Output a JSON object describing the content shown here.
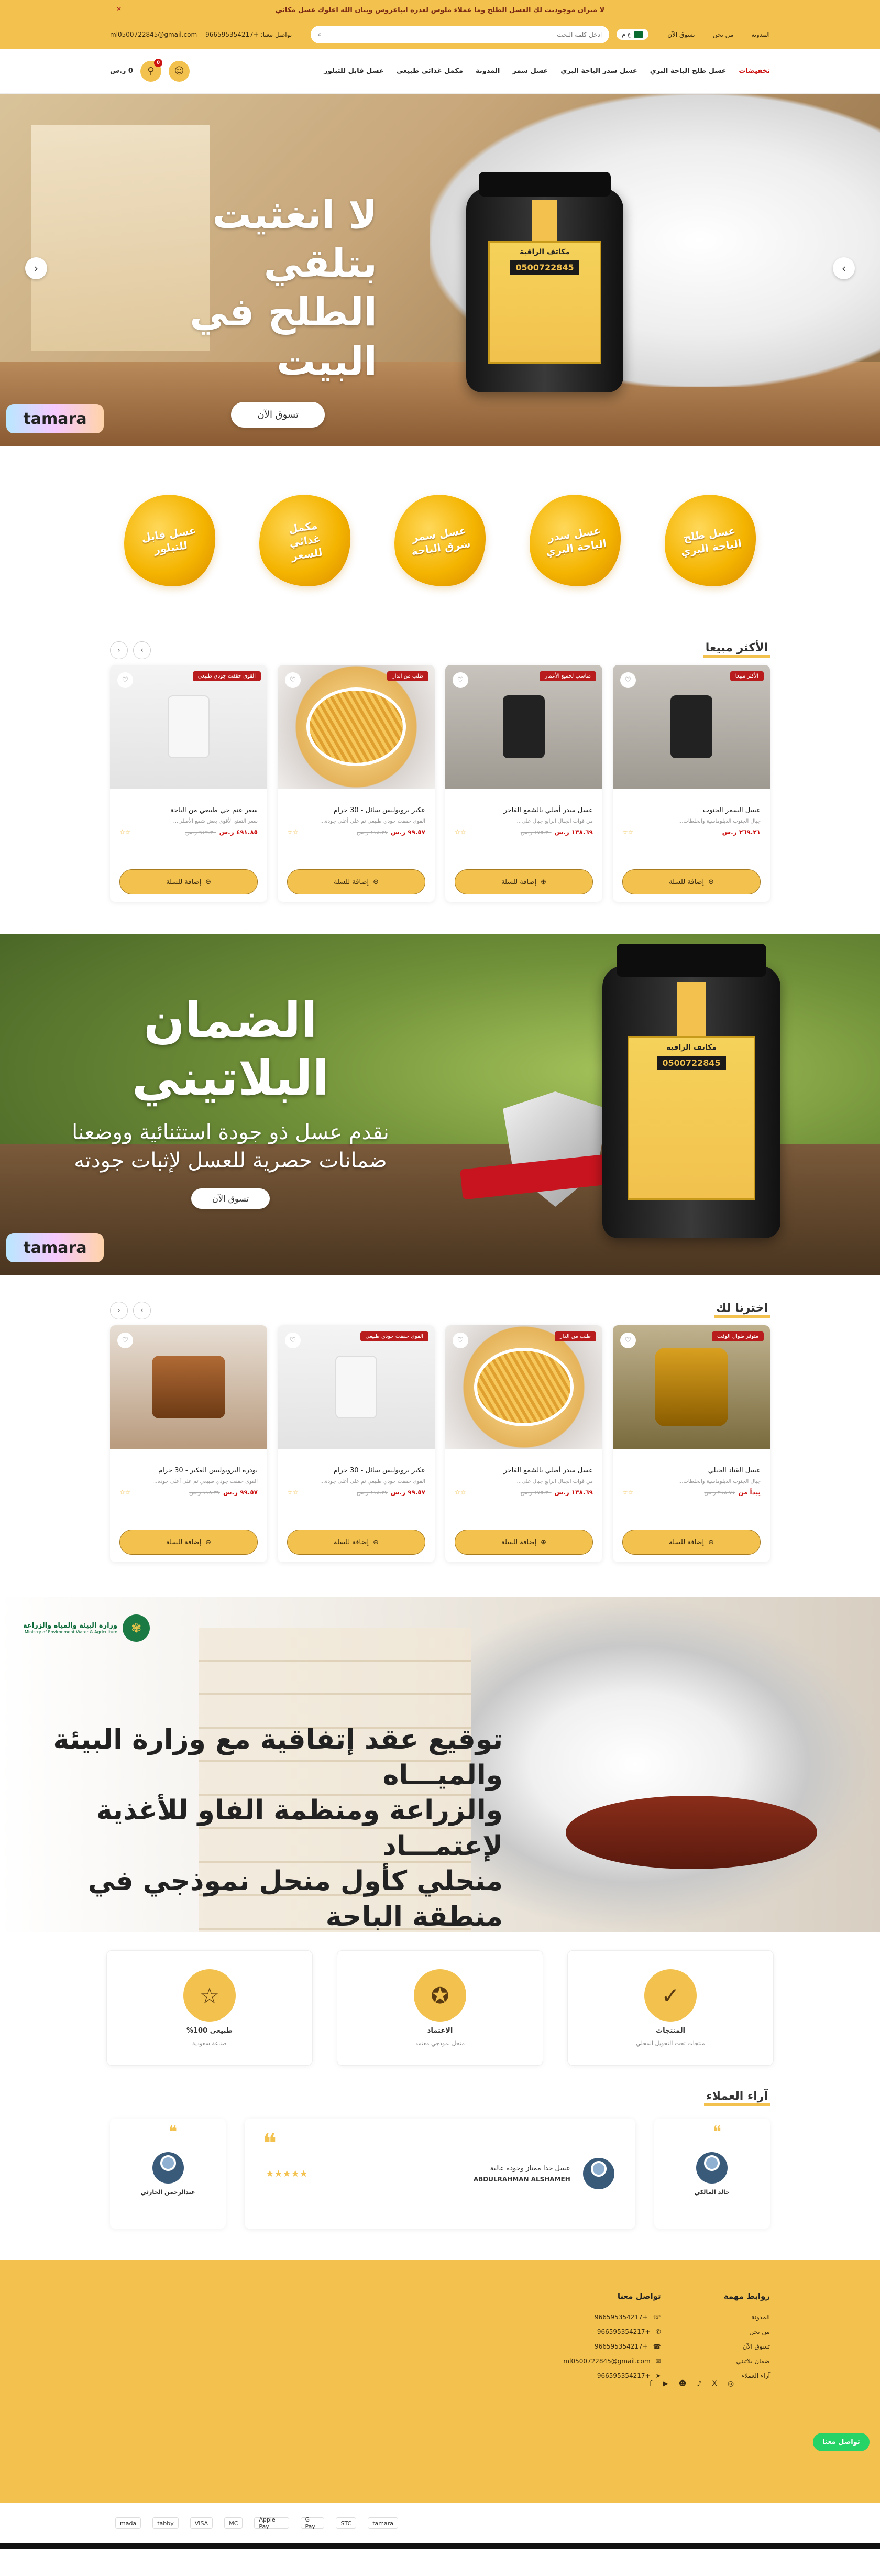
{
  "announcement": {
    "text": "لا ميزان موجوديت لك العسل الطلح وما عملاء ملوس لعذره ايباعروش وبيان الله اعلوك عسل مكاني",
    "close": "×"
  },
  "topbar": {
    "links": [
      "المدونة",
      "من نحن",
      "تسوق الآن"
    ],
    "search_placeholder": "ادخل كلمة البحث",
    "lang": "ع م",
    "phone_label": "تواصل معنا: +966595354217",
    "email": "ml0500722845@gmail.com"
  },
  "nav": {
    "items": [
      "تخفيضات",
      "عسل طلح الباحة البري",
      "عسل سدر الباحة البري",
      "عسل سمر",
      "المدونة",
      "مكمل غذائي طبيعي",
      "عسل قابل للتبلور"
    ],
    "cart_total": "0 ر.س",
    "cart_count": "0"
  },
  "hero": {
    "title": "لا انغثيت بتلقي\nالطلح في البيت",
    "cta": "تسوق الآن",
    "jar_phone": "0500722845",
    "jar_brand": "مكاتف الراقية",
    "tamara": "tamara"
  },
  "categories": [
    "عسل طلح\nالباحة البري",
    "عسل سدر\nالباحة البري",
    "عسل سمر\nشرق الباحة",
    "مكمل غذائي\nللسعر",
    "عسل قابل\nللتبلور"
  ],
  "best_sellers": {
    "title": "الأكثر مبيعا",
    "products": [
      {
        "tag": "الأكثر مبيعا",
        "name": "عسل السمر الجنوب",
        "desc": "جبال الجنوب الدبلوماسية والخلطات...",
        "price": "٢٦٩.٢١ ر.س",
        "old": "",
        "stars": "☆☆",
        "button": "إضافة للسلة",
        "img": "dark"
      },
      {
        "tag": "مناسب لجميع الأعمار",
        "name": "عسل سدر أصلي بالشمع الفاخر",
        "desc": "من قوات الجبال الرابع جبال على...",
        "price": "١٣٨.٦٩ ر.س",
        "old": "١٧٥.٣٠ ر.س",
        "stars": "☆☆",
        "button": "إضافة للسلة",
        "img": "dark"
      },
      {
        "tag": "طلب من الدار",
        "name": "عكبر بروبوليس سائل - 30 جرام",
        "desc": "القوى حققت جودي طبيعي تم على أعلى جودة...",
        "price": "٩٩.٥٧ ر.س",
        "old": "١١٨.٣٧ ر.س",
        "stars": "☆☆",
        "button": "إضافة للسلة",
        "img": "honey"
      },
      {
        "tag": "القوى حققت جودي طبيعي",
        "name": "سعر عنم جي طبيعي من الباحة",
        "desc": "سعر التمتع الأقوى بعض شمع الأصلي...",
        "price": "٤٩١.٨٥ ر.س",
        "old": "٦١٢.٣٠ ر.س",
        "stars": "☆☆",
        "button": "إضافة للسلة",
        "img": "white"
      }
    ]
  },
  "banner2": {
    "title": "الضمان البلاتيني",
    "subtitle": "نقدم عسل ذو جودة استثنائية ووضعنا\nضمانات حصرية للعسل لإثبات جودته",
    "cta": "تسوق الآن",
    "tamara": "tamara",
    "jar_phone": "0500722845"
  },
  "chosen": {
    "title": "اخترنا لك",
    "products": [
      {
        "tag": "متوفر طوال الوقت",
        "name": "عسل القتاد الجبلي",
        "desc": "جبال الجنوب الدبلوماسية والخلطات...",
        "price": "يبدأ من",
        "old": "٢١٨.٧١ ر.س",
        "stars": "☆☆",
        "button": "إضافة للسلة",
        "img": "gold"
      },
      {
        "tag": "طلب من الدار",
        "name": "عسل سدر أصلي بالشمع الفاخر",
        "desc": "من قوات الجبال الرابع جبال على...",
        "price": "١٣٨.٦٩ ر.س",
        "old": "١٧٥.٣٠ ر.س",
        "stars": "☆☆",
        "button": "إضافة للسلة",
        "img": "honey"
      },
      {
        "tag": "القوى حققت جودي طبيعي",
        "name": "عكبر بروبوليس سائل - 30 جرام",
        "desc": "القوى حققت جودي طبيعي تم على أعلى جودة...",
        "price": "٩٩.٥٧ ر.س",
        "old": "١١٨.٣٧ ر.س",
        "stars": "☆☆",
        "button": "إضافة للسلة",
        "img": "white"
      },
      {
        "tag": "",
        "name": "بودرة البروبوليس العكبر - 30 جرام",
        "desc": "القوى حققت جودي طبيعي تم على أعلى جودة...",
        "price": "٩٩.٥٧ ر.س",
        "old": "١١٨.٣٧ ر.س",
        "stars": "☆☆",
        "button": "إضافة للسلة",
        "img": "brown"
      }
    ]
  },
  "agreement": {
    "ministry_ar": "وزارة البيئة والمياه والزراعة",
    "ministry_en": "Ministry of Environment Water & Agriculture",
    "text": "توقيع عقد إتفاقية مع وزارة البيئة والميـــاه\nوالزراعة ومنظمة الفاو للأغذية لإعتمـــاد\nمنحلي كأول منحل نموذجي في منطقة الباحة"
  },
  "features": [
    {
      "title": "المنتجات",
      "sub": "منتجات تحت التحويل المحلي",
      "icon": "check-badge-icon",
      "glyph": "✓"
    },
    {
      "title": "الاعتماد",
      "sub": "منحل نموذجي معتمد",
      "icon": "award-icon",
      "glyph": "✪"
    },
    {
      "title": "طبيعي 100%",
      "sub": "صناعة سعودية",
      "icon": "star-icon",
      "glyph": "☆"
    }
  ],
  "reviews": {
    "title": "آراء العملاء",
    "side_right": {
      "name": "خالد المالكي"
    },
    "main": {
      "name": "ABDULRAHMAN ALSHAMEH",
      "text": "عسل جدا ممتاز وجودة عالية",
      "stars": "★★★★★"
    },
    "side_left": {
      "name": "عبدالرحمن الحارثي"
    }
  },
  "footer": {
    "links_title": "روابط مهمة",
    "links": [
      "المدونة",
      "من نحن",
      "تسوق الآن",
      "ضمان بلاتيني",
      "آراء العملاء"
    ],
    "contact_title": "تواصل معنا",
    "contacts": [
      {
        "icon": "whatsapp-icon",
        "glyph": "☏",
        "text": "+966595354217"
      },
      {
        "icon": "phone-icon",
        "glyph": "✆",
        "text": "+966595354217"
      },
      {
        "icon": "mobile-icon",
        "glyph": "☎",
        "text": "+966595354217"
      },
      {
        "icon": "mail-icon",
        "glyph": "✉",
        "text": "ml0500722845@gmail.com"
      },
      {
        "icon": "telegram-icon",
        "glyph": "➤",
        "text": "+966595354217"
      }
    ],
    "social": [
      "◎",
      "X",
      "♪",
      "☻",
      "▶",
      "f"
    ],
    "whatsapp_btn": "تواصل معنا"
  },
  "payments": [
    "mada",
    "tabby",
    "VISA",
    "MC",
    "Apple Pay",
    "G Pay",
    "STC",
    "tamara"
  ],
  "colors": {
    "accent": "#f2c14e",
    "sale": "#c11"
  }
}
